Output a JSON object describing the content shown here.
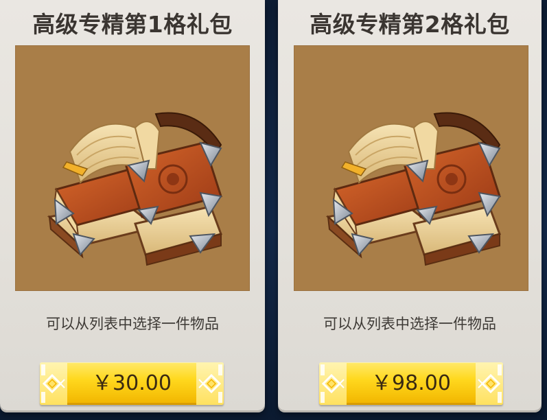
{
  "packs": [
    {
      "title": "高级专精第1格礼包",
      "icon": "book-bundle-icon",
      "description": "可以从列表中选择一件物品",
      "price": "￥30.00"
    },
    {
      "title": "高级专精第2格礼包",
      "icon": "book-bundle-icon",
      "description": "可以从列表中选择一件物品",
      "price": "￥98.00"
    }
  ],
  "colors": {
    "card_background": "#e6e3de",
    "artwork_background": "#a97e48",
    "button_yellow": "#ffd81e",
    "page_background": "#10223d"
  }
}
